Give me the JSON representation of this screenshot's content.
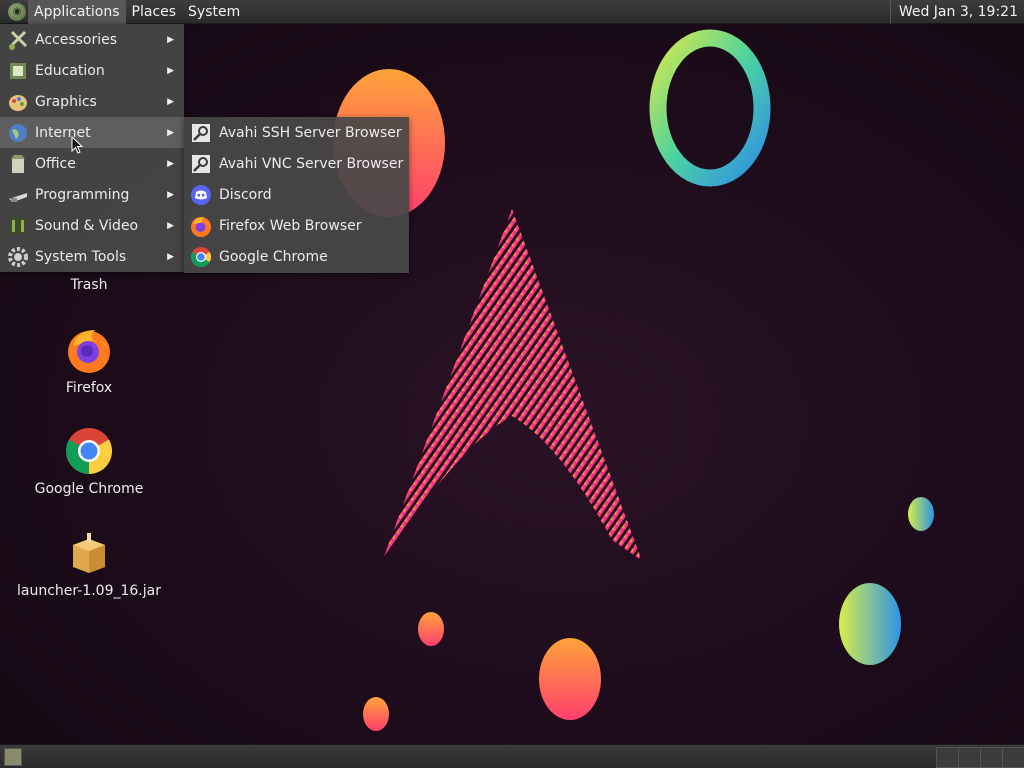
{
  "top_panel": {
    "menus": [
      "Applications",
      "Places",
      "System"
    ],
    "clock": "Wed Jan  3, 19:21"
  },
  "app_menu": {
    "items": [
      {
        "label": "Accessories",
        "icon": "accessories-icon"
      },
      {
        "label": "Education",
        "icon": "education-icon"
      },
      {
        "label": "Graphics",
        "icon": "graphics-icon"
      },
      {
        "label": "Internet",
        "icon": "internet-globe-icon"
      },
      {
        "label": "Office",
        "icon": "office-icon"
      },
      {
        "label": "Programming",
        "icon": "programming-icon"
      },
      {
        "label": "Sound & Video",
        "icon": "sound-video-icon"
      },
      {
        "label": "System Tools",
        "icon": "system-tools-gear-icon"
      }
    ],
    "highlighted": "Internet"
  },
  "internet_submenu": {
    "items": [
      {
        "label": "Avahi SSH Server Browser",
        "icon": "avahi-icon"
      },
      {
        "label": "Avahi VNC Server Browser",
        "icon": "avahi-icon"
      },
      {
        "label": "Discord",
        "icon": "discord-icon"
      },
      {
        "label": "Firefox Web Browser",
        "icon": "firefox-icon"
      },
      {
        "label": "Google Chrome",
        "icon": "chrome-icon"
      }
    ]
  },
  "desktop_icons": [
    {
      "label": "Trash",
      "icon": "trash-icon"
    },
    {
      "label": "Firefox",
      "icon": "firefox-icon"
    },
    {
      "label": "Google Chrome",
      "icon": "chrome-icon"
    },
    {
      "label": "launcher-1.09_16.jar",
      "icon": "jar-package-icon"
    }
  ],
  "colors": {
    "panel": "#2e2e2e",
    "menu_bg": "#484848",
    "menu_highlight": "#5e5e5e",
    "desktop_bg": "#1d0c1b"
  }
}
